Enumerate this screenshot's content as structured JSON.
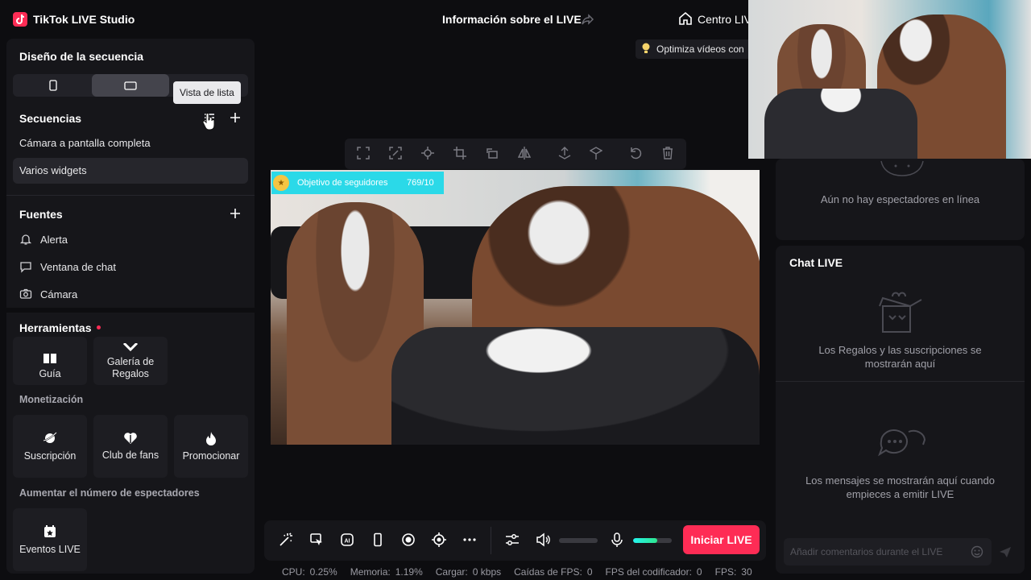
{
  "app": {
    "title": "TikTok LIVE Studio"
  },
  "header": {
    "live_info": "Información sobre el LIVE",
    "centro": "Centro LIV",
    "tip": "Optimiza vídeos con"
  },
  "left": {
    "seq_design_title": "Diseño de la secuencia",
    "tooltip": "Vista de lista",
    "sequences_title": "Secuencias",
    "sequences": [
      "Cámara a pantalla completa",
      "Varios widgets"
    ],
    "sources_title": "Fuentes",
    "sources": [
      "Alerta",
      "Ventana de chat",
      "Cámara"
    ],
    "tools_title": "Herramientas",
    "tools_top": [
      "Guía",
      "Galería de Regalos"
    ],
    "monet_title": "Monetización",
    "monet": [
      "Suscripción",
      "Club de fans",
      "Promocionar"
    ],
    "boost_title": "Aumentar el número de espectadores",
    "boost": [
      "Eventos LIVE"
    ]
  },
  "preview": {
    "goal_label": "Objetivo de seguidores",
    "goal_count": "769/10"
  },
  "right": {
    "viewers_empty": "Aún no hay espectadores en línea",
    "chat_title": "Chat LIVE",
    "gifts_empty": "Los Regalos y las suscripciones se mostrarán aquí",
    "msgs_empty": "Los mensajes se mostrarán aquí cuando empieces a emitir LIVE",
    "comment_placeholder": "Añadir comentarios durante el LIVE"
  },
  "controls": {
    "go_live": "Iniciar LIVE",
    "mic_level": 0.62
  },
  "status": {
    "cpu_label": "CPU:",
    "cpu": "0.25%",
    "mem_label": "Memoria:",
    "mem": "1.19%",
    "load_label": "Cargar:",
    "load": "0 kbps",
    "fps_drop_label": "Caídas de FPS:",
    "fps_drop": "0",
    "enc_fps_label": "FPS del codificador:",
    "enc_fps": "0",
    "fps_label": "FPS:",
    "fps": "30"
  },
  "colors": {
    "accent": "#fe2c55",
    "goal": "#2bd9e8",
    "mic": "#2ee68e"
  }
}
